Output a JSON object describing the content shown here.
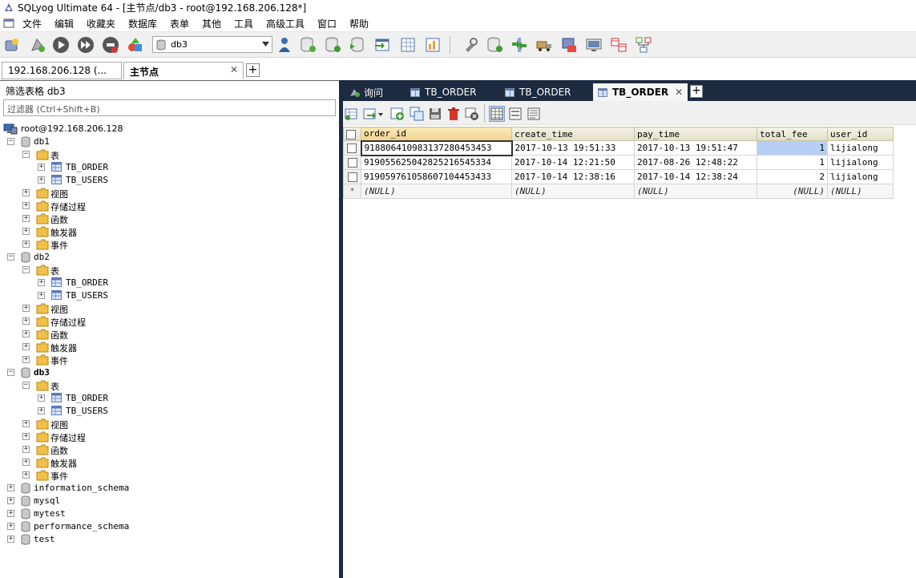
{
  "window": {
    "title": "SQLyog Ultimate 64 - [主节点/db3 - root@192.168.206.128*]"
  },
  "menu": [
    "文件",
    "编辑",
    "收藏夹",
    "数据库",
    "表单",
    "其他",
    "工具",
    "高级工具",
    "窗口",
    "帮助"
  ],
  "toolbar": {
    "database_select": "db3"
  },
  "connection_tabs": [
    {
      "label": "192.168.206.128 (..."
    },
    {
      "label": "主节点"
    }
  ],
  "left_panel": {
    "filter_label": "筛选表格 db3",
    "filter_placeholder": "过滤器 (Ctrl+Shift+B)",
    "tree": [
      {
        "label": "root@192.168.206.128"
      },
      {
        "label": "db1"
      },
      {
        "label": "表"
      },
      {
        "label": "TB_ORDER"
      },
      {
        "label": "TB_USERS"
      },
      {
        "label": "视图"
      },
      {
        "label": "存储过程"
      },
      {
        "label": "函数"
      },
      {
        "label": "触发器"
      },
      {
        "label": "事件"
      },
      {
        "label": "db2"
      },
      {
        "label": "表"
      },
      {
        "label": "TB_ORDER"
      },
      {
        "label": "TB_USERS"
      },
      {
        "label": "视图"
      },
      {
        "label": "存储过程"
      },
      {
        "label": "函数"
      },
      {
        "label": "触发器"
      },
      {
        "label": "事件"
      },
      {
        "label": "db3"
      },
      {
        "label": "表"
      },
      {
        "label": "TB_ORDER"
      },
      {
        "label": "TB_USERS"
      },
      {
        "label": "视图"
      },
      {
        "label": "存储过程"
      },
      {
        "label": "函数"
      },
      {
        "label": "触发器"
      },
      {
        "label": "事件"
      },
      {
        "label": "information_schema"
      },
      {
        "label": "mysql"
      },
      {
        "label": "mytest"
      },
      {
        "label": "performance_schema"
      },
      {
        "label": "test"
      }
    ]
  },
  "query_tabs": [
    {
      "label": "询问"
    },
    {
      "label": "TB_ORDER"
    },
    {
      "label": "TB_ORDER"
    },
    {
      "label": "TB_ORDER"
    }
  ],
  "grid": {
    "columns": [
      "order_id",
      "create_time",
      "pay_time",
      "total_fee",
      "user_id"
    ],
    "rows": [
      [
        "918806410983137280453453",
        "2017-10-13 19:51:33",
        "2017-10-13 19:51:47",
        "1",
        "lijialong"
      ],
      [
        "919055625042825216545334",
        "2017-10-14 12:21:50",
        "2017-08-26 12:48:22",
        "1",
        "lijialong"
      ],
      [
        "919059761058607104453433",
        "2017-10-14 12:38:16",
        "2017-10-14 12:38:24",
        "2",
        "lijialong"
      ]
    ],
    "new_row_marker": "*",
    "null_text": [
      "(NULL)",
      "(NULL)",
      "(NULL)",
      "(NULL)",
      "(NULL)"
    ]
  }
}
